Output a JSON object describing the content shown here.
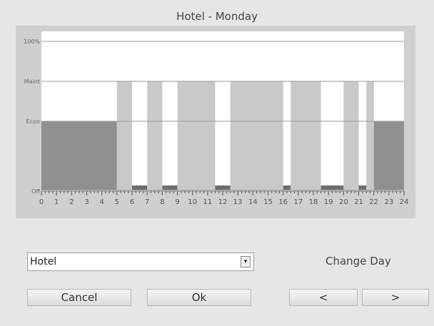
{
  "window": {
    "title": "Hotel - Monday"
  },
  "chart_data": {
    "type": "bar",
    "y_tick_labels": [
      "100%",
      "Maint",
      "Econ",
      "Off"
    ],
    "x_tick_labels": [
      "0",
      "1",
      "2",
      "3",
      "4",
      "5",
      "6",
      "7",
      "8",
      "9",
      "10",
      "11",
      "12",
      "13",
      "14",
      "15",
      "16",
      "17",
      "18",
      "19",
      "20",
      "21",
      "22",
      "23",
      "24"
    ],
    "xlim": [
      0,
      24
    ],
    "segments": [
      {
        "start": 0,
        "end": 5,
        "level": "Econ"
      },
      {
        "start": 5,
        "end": 6,
        "level": "Maint"
      },
      {
        "start": 6,
        "end": 7,
        "level": "Off"
      },
      {
        "start": 7,
        "end": 8,
        "level": "Maint"
      },
      {
        "start": 8,
        "end": 9,
        "level": "Off"
      },
      {
        "start": 9,
        "end": 11.5,
        "level": "Maint"
      },
      {
        "start": 11.5,
        "end": 12.5,
        "level": "Off"
      },
      {
        "start": 12.5,
        "end": 16,
        "level": "Maint"
      },
      {
        "start": 16,
        "end": 16.5,
        "level": "Off"
      },
      {
        "start": 16.5,
        "end": 18.5,
        "level": "Maint"
      },
      {
        "start": 18.5,
        "end": 20,
        "level": "Off"
      },
      {
        "start": 20,
        "end": 21,
        "level": "Maint"
      },
      {
        "start": 21,
        "end": 21.5,
        "level": "Off"
      },
      {
        "start": 21.5,
        "end": 22,
        "level": "Maint"
      },
      {
        "start": 22,
        "end": 24,
        "level": "Econ"
      }
    ],
    "colors": {
      "econ": "#909090",
      "maint": "#c9c9c9",
      "off": "#6e6e6e",
      "background": "#ffffff",
      "frame": "#cfcfcf"
    }
  },
  "controls": {
    "zone_select": {
      "value": "Hotel",
      "arrow": "▾"
    },
    "change_day_label": "Change Day",
    "cancel_label": "Cancel",
    "ok_label": "Ok",
    "prev_label": "<",
    "next_label": ">"
  }
}
